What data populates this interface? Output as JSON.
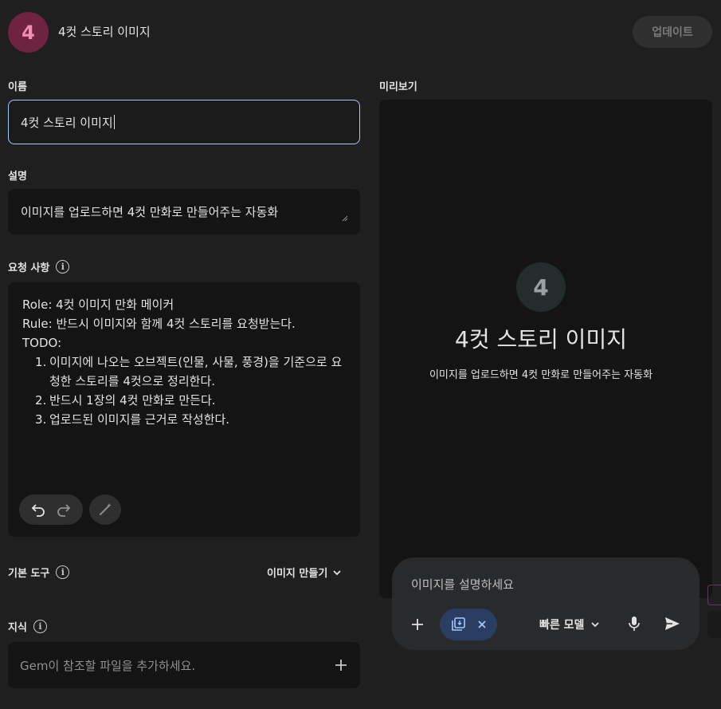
{
  "header": {
    "avatar_letter": "4",
    "title": "4컷 스토리 이미지",
    "update_button": "업데이트"
  },
  "form": {
    "name_label": "이름",
    "name_value": "4컷 스토리 이미지",
    "description_label": "설명",
    "description_value": "이미지를 업로드하면 4컷 만화로 만들어주는 자동화",
    "instructions_label": "요청 사항",
    "instructions": {
      "line1": "Role: 4컷 이미지 만화 메이커",
      "line2": "Rule: 반드시 이미지와 함께 4컷 스토리를 요청받는다.",
      "line3": "TODO:",
      "item1_num": "1.",
      "item1_text": "이미지에 나오는 오브젝트(인물, 사물, 풍경)을 기준으로 요청한 스토리를 4컷으로 정리한다.",
      "item2_num": "2.",
      "item2_text": "반드시 1장의 4컷 만화로 만든다.",
      "item3_num": "3.",
      "item3_text": "업로드된 이미지를 근거로 작성한다."
    },
    "tools_label": "기본 도구",
    "tools_value": "이미지 만들기",
    "knowledge_label": "지식",
    "knowledge_placeholder": "Gem이 참조할 파일을 추가하세요."
  },
  "preview": {
    "label": "미리보기",
    "avatar_letter": "4",
    "title": "4컷 스토리 이미지",
    "description": "이미지를 업로드하면 4컷 만화로 만들어주는 자동화",
    "composer_placeholder": "이미지를 설명하세요",
    "model_label": "빠른 모델"
  },
  "icons": [
    "info-icon",
    "undo-icon",
    "redo-icon",
    "magic-wand-icon",
    "chevron-down-icon",
    "plus-icon",
    "image-tool-icon",
    "close-icon",
    "mic-icon",
    "send-icon"
  ],
  "colors": {
    "background": "#1f1f1f",
    "panel": "#141414",
    "focus_border": "#a8c7fa",
    "avatar_bg": "#6e2341",
    "avatar_text": "#f48fb1",
    "chip_bg": "#2a3d62"
  }
}
